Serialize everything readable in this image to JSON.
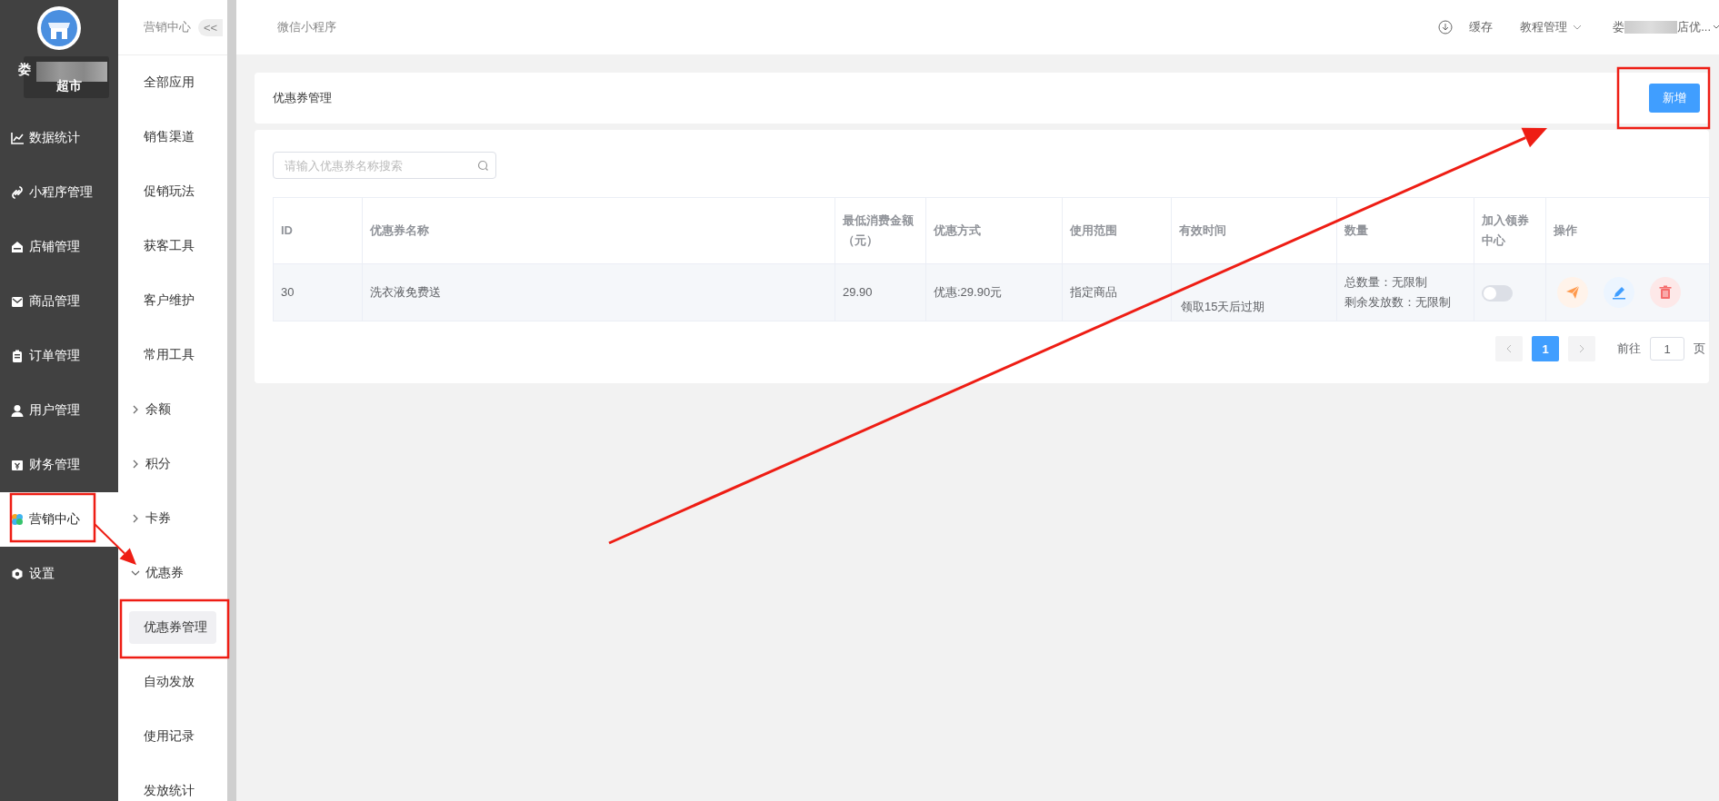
{
  "sidebar": {
    "store_name": [
      "娄",
      "超市"
    ],
    "items": [
      {
        "label": "数据统计",
        "selected": false
      },
      {
        "label": "小程序管理",
        "selected": false
      },
      {
        "label": "店铺管理",
        "selected": false
      },
      {
        "label": "商品管理",
        "selected": false
      },
      {
        "label": "订单管理",
        "selected": false
      },
      {
        "label": "用户管理",
        "selected": false
      },
      {
        "label": "财务管理",
        "selected": false
      },
      {
        "label": "营销中心",
        "selected": true
      },
      {
        "label": "设置",
        "selected": false
      }
    ]
  },
  "submenu": {
    "title": "营销中心",
    "collapse": "<<",
    "items": [
      {
        "label": "全部应用",
        "kind": "link"
      },
      {
        "label": "销售渠道",
        "kind": "link"
      },
      {
        "label": "促销玩法",
        "kind": "link"
      },
      {
        "label": "获客工具",
        "kind": "link"
      },
      {
        "label": "客户维护",
        "kind": "link"
      },
      {
        "label": "常用工具",
        "kind": "link"
      },
      {
        "label": "余额",
        "kind": "group",
        "expanded": false
      },
      {
        "label": "积分",
        "kind": "group",
        "expanded": false
      },
      {
        "label": "卡券",
        "kind": "group",
        "expanded": false
      },
      {
        "label": "优惠券",
        "kind": "group",
        "expanded": true,
        "children": [
          {
            "label": "优惠券管理",
            "selected": true
          },
          {
            "label": "自动发放",
            "selected": false
          },
          {
            "label": "使用记录",
            "selected": false
          },
          {
            "label": "发放统计",
            "selected": false
          }
        ]
      }
    ]
  },
  "topbar": {
    "title": "微信小程序",
    "cache": "缓存",
    "tutorial": "教程管理",
    "user": [
      "娄",
      "店优..."
    ]
  },
  "page": {
    "title": "优惠券管理",
    "add_button": "新增"
  },
  "search": {
    "placeholder": "请输入优惠券名称搜索"
  },
  "table": {
    "columns": [
      "ID",
      "优惠券名称",
      "最低消费金额（元）",
      "优惠方式",
      "使用范围",
      "有效时间",
      "数量",
      "加入领券中心",
      "操作"
    ],
    "rows": [
      {
        "cells": [
          "30",
          "洗衣液免费送",
          "29.90",
          "优惠:29.90元",
          "指定商品",
          "领取15天后过期"
        ],
        "quantity": [
          "总数量：无限制",
          "剩余发放数：无限制"
        ],
        "in_center": false
      }
    ]
  },
  "pagination": {
    "pages": [
      {
        "label": "1",
        "selected": true
      }
    ],
    "goto_label": "前往",
    "goto_value": "1",
    "page_suffix": "页"
  }
}
